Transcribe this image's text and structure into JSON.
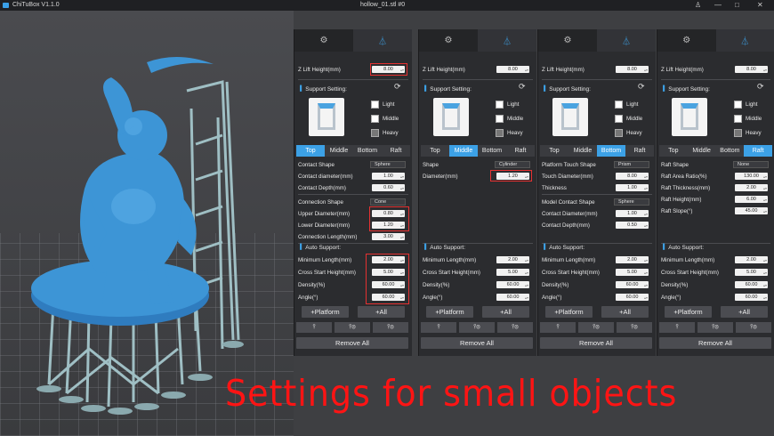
{
  "app": {
    "title": "ChiTuBox V1.1.0",
    "document": "hollow_01.stl #0"
  },
  "window_controls": {
    "user": "♙",
    "min": "—",
    "max": "□",
    "close": "✕"
  },
  "tab_icons": {
    "settings": "settings-icon",
    "support": "support-icon"
  },
  "common": {
    "z_lift_label": "Z Lift Height(mm)",
    "z_lift_value": "8.00",
    "support_setting": "Support Setting:",
    "light": "Light",
    "middle": "Middle",
    "heavy": "Heavy",
    "seg_top": "Top",
    "seg_middle": "Middle",
    "seg_bottom": "Bottom",
    "seg_raft": "Raft",
    "auto_support": "Auto Support:",
    "min_length_label": "Minimum Length(mm)",
    "min_length": "2.00",
    "cross_start_label": "Cross Start Height(mm)",
    "cross_start": "5.00",
    "density_label": "Density(%)",
    "density": "60.00",
    "angle_label": "Angle(°)",
    "angle": "60.00",
    "platform_btn": "+Platform",
    "all_btn": "+All",
    "remove_all": "Remove All"
  },
  "panel1": {
    "contact_shape_label": "Contact Shape",
    "contact_shape": "Sphere",
    "contact_diameter_label": "Contact diameter(mm)",
    "contact_diameter": "1.00",
    "contact_depth_label": "Contact Depth(mm)",
    "contact_depth": "0.60",
    "connection_shape_label": "Connection Shape",
    "connection_shape": "Cone",
    "upper_diameter_label": "Upper Diameter(mm)",
    "upper_diameter": "0.80",
    "lower_diameter_label": "Lower Diameter(mm)",
    "lower_diameter": "1.20",
    "connection_length_label": "Connection Length(mm)",
    "connection_length": "3.00"
  },
  "panel2": {
    "shape_label": "Shape",
    "shape": "Cylinder",
    "diameter_label": "Diameter(mm)",
    "diameter": "1.20"
  },
  "panel3": {
    "platform_touch_shape_label": "Platform Touch Shape",
    "platform_touch_shape": "Prism",
    "touch_diameter_label": "Touch Diameter(mm)",
    "touch_diameter": "8.00",
    "thickness_label": "Thickness",
    "thickness": "1.00",
    "model_contact_shape_label": "Model Contact Shape",
    "model_contact_shape": "Sphere",
    "contact_diameter_label": "Contact Diameter(mm)",
    "contact_diameter": "1.00",
    "contact_depth_label": "Contact Depth(mm)",
    "contact_depth": "0.50"
  },
  "panel4": {
    "raft_shape_label": "Raft Shape",
    "raft_shape": "None",
    "raft_area_label": "Raft Area Ratio(%)",
    "raft_area": "130.00",
    "raft_thickness_label": "Raft Thickness(mm)",
    "raft_thickness": "2.00",
    "raft_height_label": "Raft Height(mm)",
    "raft_height": "6.00",
    "raft_slope_label": "Raft Slope(°)",
    "raft_slope": "45.00"
  },
  "caption": "Settings for small objects",
  "colors": {
    "accent": "#3ca1e6",
    "highlight": "#e53131",
    "caption": "#ff1414",
    "model": "#3d95d6",
    "supports": "#8fb2b8"
  }
}
